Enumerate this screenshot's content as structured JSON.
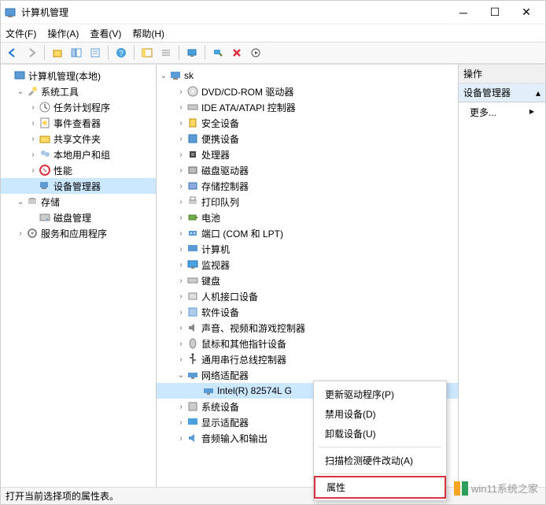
{
  "window": {
    "title": "计算机管理"
  },
  "menubar": [
    "文件(F)",
    "操作(A)",
    "查看(V)",
    "帮助(H)"
  ],
  "left_tree": [
    {
      "ind": 0,
      "twist": "",
      "label": "计算机管理(本地)",
      "icon": "mgmt"
    },
    {
      "ind": 1,
      "twist": "v",
      "label": "系统工具",
      "icon": "tools"
    },
    {
      "ind": 2,
      "twist": ">",
      "label": "任务计划程序",
      "icon": "task"
    },
    {
      "ind": 2,
      "twist": ">",
      "label": "事件查看器",
      "icon": "event"
    },
    {
      "ind": 2,
      "twist": ">",
      "label": "共享文件夹",
      "icon": "share"
    },
    {
      "ind": 2,
      "twist": ">",
      "label": "本地用户和组",
      "icon": "users"
    },
    {
      "ind": 2,
      "twist": ">",
      "label": "性能",
      "icon": "perf"
    },
    {
      "ind": 2,
      "twist": "",
      "label": "设备管理器",
      "icon": "device",
      "sel": true
    },
    {
      "ind": 1,
      "twist": "v",
      "label": "存储",
      "icon": "storage"
    },
    {
      "ind": 2,
      "twist": "",
      "label": "磁盘管理",
      "icon": "disk"
    },
    {
      "ind": 1,
      "twist": ">",
      "label": "服务和应用程序",
      "icon": "services"
    }
  ],
  "mid_tree": [
    {
      "ind": 0,
      "twist": "v",
      "label": "sk",
      "icon": "pc"
    },
    {
      "ind": 1,
      "twist": ">",
      "label": "DVD/CD-ROM 驱动器",
      "icon": "cd"
    },
    {
      "ind": 1,
      "twist": ">",
      "label": "IDE ATA/ATAPI 控制器",
      "icon": "ide"
    },
    {
      "ind": 1,
      "twist": ">",
      "label": "安全设备",
      "icon": "sec"
    },
    {
      "ind": 1,
      "twist": ">",
      "label": "便携设备",
      "icon": "port"
    },
    {
      "ind": 1,
      "twist": ">",
      "label": "处理器",
      "icon": "cpu"
    },
    {
      "ind": 1,
      "twist": ">",
      "label": "磁盘驱动器",
      "icon": "hdd"
    },
    {
      "ind": 1,
      "twist": ">",
      "label": "存储控制器",
      "icon": "stor"
    },
    {
      "ind": 1,
      "twist": ">",
      "label": "打印队列",
      "icon": "print"
    },
    {
      "ind": 1,
      "twist": ">",
      "label": "电池",
      "icon": "batt"
    },
    {
      "ind": 1,
      "twist": ">",
      "label": "端口 (COM 和 LPT)",
      "icon": "com"
    },
    {
      "ind": 1,
      "twist": ">",
      "label": "计算机",
      "icon": "comp"
    },
    {
      "ind": 1,
      "twist": ">",
      "label": "监视器",
      "icon": "mon"
    },
    {
      "ind": 1,
      "twist": ">",
      "label": "键盘",
      "icon": "kb"
    },
    {
      "ind": 1,
      "twist": ">",
      "label": "人机接口设备",
      "icon": "hid"
    },
    {
      "ind": 1,
      "twist": ">",
      "label": "软件设备",
      "icon": "soft"
    },
    {
      "ind": 1,
      "twist": ">",
      "label": "声音、视频和游戏控制器",
      "icon": "snd"
    },
    {
      "ind": 1,
      "twist": ">",
      "label": "鼠标和其他指针设备",
      "icon": "mouse"
    },
    {
      "ind": 1,
      "twist": ">",
      "label": "通用串行总线控制器",
      "icon": "usb"
    },
    {
      "ind": 1,
      "twist": "v",
      "label": "网络适配器",
      "icon": "net"
    },
    {
      "ind": 2,
      "twist": "",
      "label": "Intel(R) 82574L G",
      "icon": "neta",
      "hl": true
    },
    {
      "ind": 1,
      "twist": ">",
      "label": "系统设备",
      "icon": "sys"
    },
    {
      "ind": 1,
      "twist": ">",
      "label": "显示适配器",
      "icon": "disp"
    },
    {
      "ind": 1,
      "twist": ">",
      "label": "音频输入和输出",
      "icon": "audio"
    }
  ],
  "right_pane": {
    "header": "操作",
    "section": "设备管理器",
    "more": "更多..."
  },
  "context_menu": {
    "items": [
      {
        "label": "更新驱动程序(P)"
      },
      {
        "label": "禁用设备(D)"
      },
      {
        "label": "卸载设备(U)"
      }
    ],
    "scan": "扫描检测硬件改动(A)",
    "props": "属性"
  },
  "statusbar": "打开当前选择项的属性表。",
  "watermark": "win11系统之家"
}
